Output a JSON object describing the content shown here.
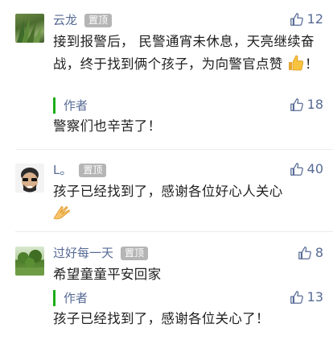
{
  "comments": [
    {
      "name": "云龙",
      "badge": "置顶",
      "likes": "12",
      "text": "接到报警后， 民警通宵未休息，天亮继续奋战，终于找到俩个孩子，为向警官点赞",
      "text_suffix": "！",
      "emoji": "thumbs-up-emoji",
      "reply": {
        "author": "作者",
        "likes": "18",
        "text": "警察们也辛苦了！"
      }
    },
    {
      "name": "L。",
      "badge": "置顶",
      "likes": "40",
      "text": "孩子已经找到了，感谢各位好心人关心",
      "emoji": "clap-emoji"
    },
    {
      "name": "过好每一天",
      "badge": "置顶",
      "likes": "8",
      "text": "希望童童平安回家",
      "reply": {
        "author": "作者",
        "likes": "13",
        "text": "孩子已经找到了，感谢各位关心了！"
      }
    }
  ],
  "colors": {
    "name": "#576b95",
    "badge_bg": "#b5b5b5",
    "author_bar": "#1aad19"
  }
}
